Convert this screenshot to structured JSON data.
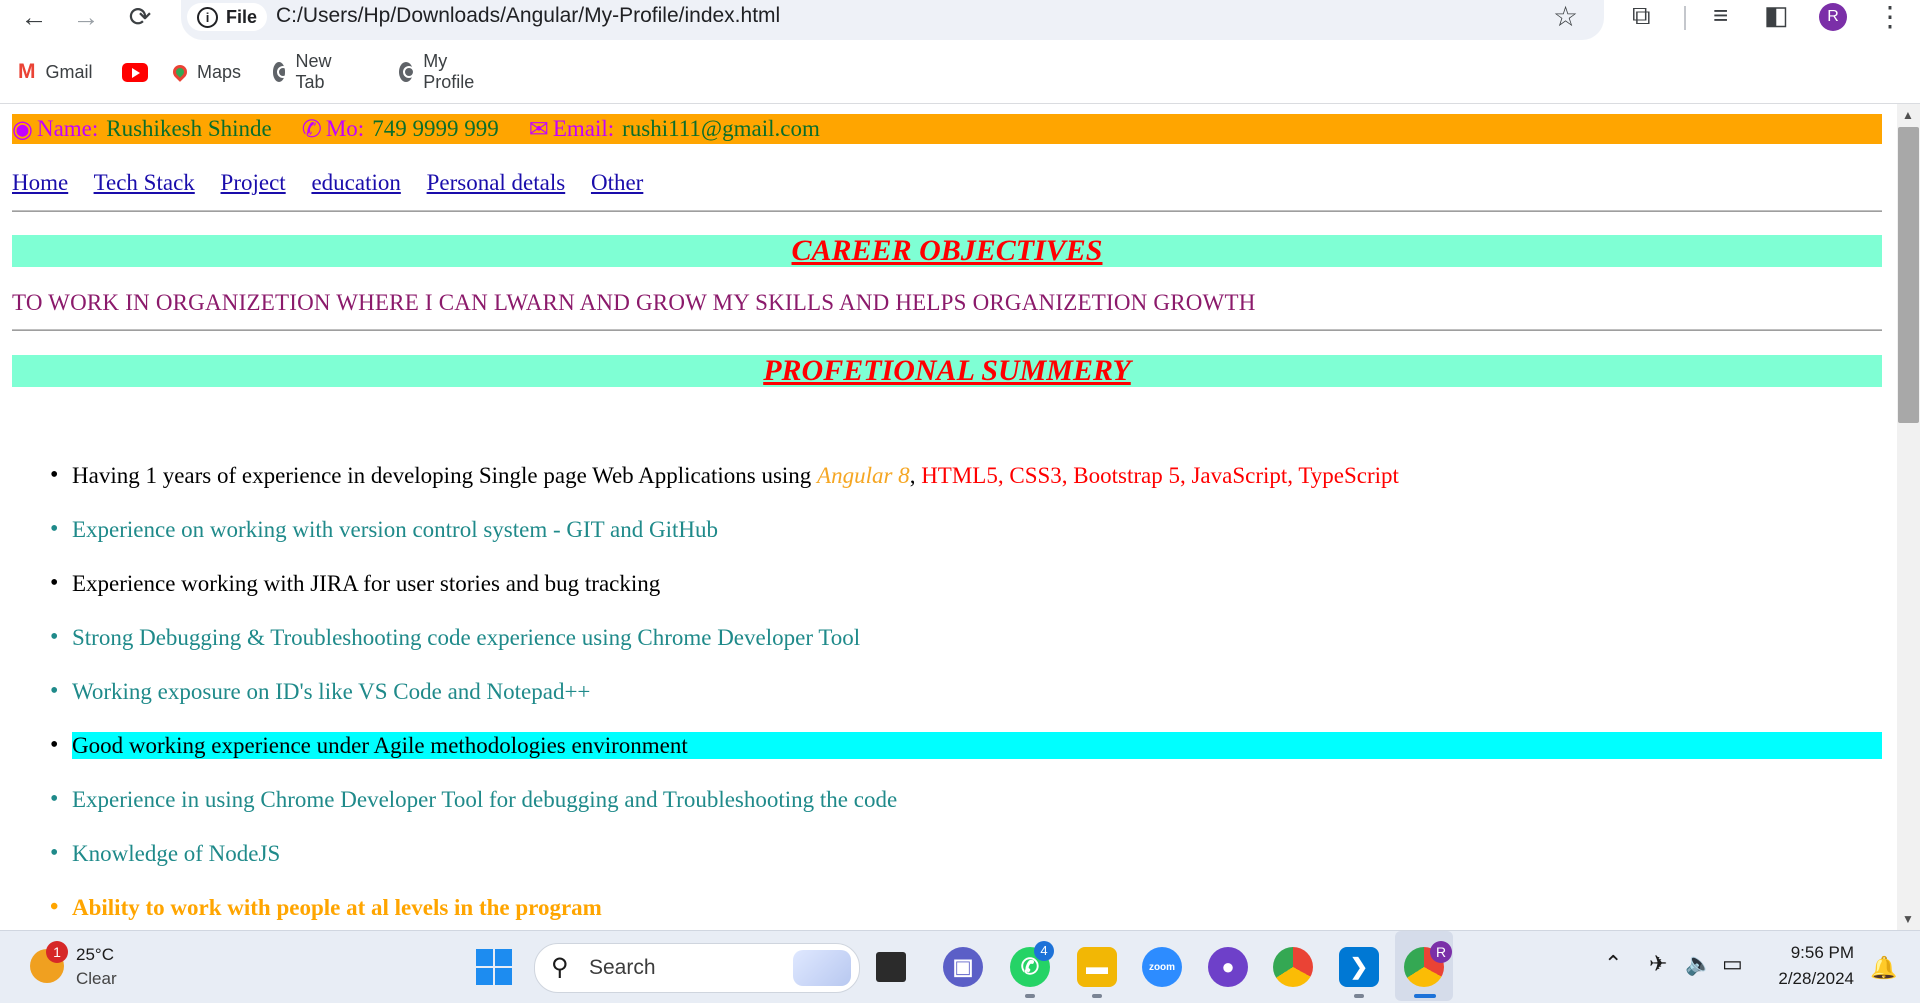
{
  "browser": {
    "chip_label": "File",
    "url": "C:/Users/Hp/Downloads/Angular/My-Profile/index.html",
    "profile_initial": "R",
    "bookmarks": [
      {
        "label": "Gmail",
        "icon": "gmail-icon"
      },
      {
        "label": "",
        "icon": "youtube-icon"
      },
      {
        "label": "Maps",
        "icon": "maps-icon"
      },
      {
        "label": "New Tab",
        "icon": "globe-icon"
      },
      {
        "label": "My Profile",
        "icon": "globe-icon"
      }
    ]
  },
  "contact": {
    "name_label": "Name:",
    "name_value": "Rushikesh Shinde",
    "mobile_label": "Mo:",
    "mobile_value": "749 9999 999",
    "email_label": "Email:",
    "email_value": "rushi111@gmail.com"
  },
  "nav": [
    "Home",
    "Tech Stack",
    "Project",
    "education",
    "Personal detals",
    "Other"
  ],
  "career": {
    "heading": "CAREER OBJECTIVES",
    "text": "TO WORK IN ORGANIZETION WHERE I CAN LWARN AND GROW MY SKILLS AND HELPS ORGANIZETION GROWTH"
  },
  "summary": {
    "heading": "PROFETIONAL SUMMERY",
    "item1_prefix": "Having 1 years of experience in developing Single page Web Applications using ",
    "item1_angular": "Angular 8",
    "item1_comma": ", ",
    "item1_rest": "HTML5, CSS3, Bootstrap 5, JavaScript, TypeScript",
    "items": [
      "Experience on working with version control system - GIT and GitHub",
      "Experience working with JIRA for user stories and bug tracking",
      "Strong Debugging & Troubleshooting code experience using Chrome Developer Tool",
      "Working exposure on ID's like VS Code and Notepad++",
      "Good working experience under Agile methodologies environment",
      "Experience in using Chrome Developer Tool for debugging and Troubleshooting the code",
      "Knowledge of NodeJS",
      "Ability to work with people at al levels in the program"
    ]
  },
  "taskbar": {
    "weather_badge": "1",
    "temperature": "25°C",
    "condition": "Clear",
    "search_label": "Search",
    "whatsapp_badge": "4",
    "zoom_label": "zoom",
    "chrome_profile_badge": "R",
    "time": "9:56 PM",
    "date": "2/28/2024"
  },
  "colors": {
    "contact_bar": "#ffa500",
    "section_heading_bg": "#7fffd4",
    "section_heading_text": "#ff0000",
    "highlight": "#00ffff"
  }
}
